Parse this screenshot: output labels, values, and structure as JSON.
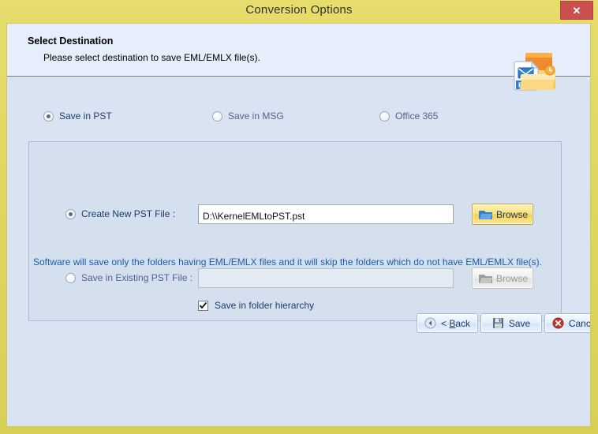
{
  "window": {
    "title": "Conversion Options",
    "close_label": "✕",
    "frame_color": "#ddd45c",
    "panel_color": "#d9e3f1",
    "close_color": "#c9504f"
  },
  "header": {
    "title": "Select Destination",
    "subtitle": "Please select destination to save EML/EMLX file(s).",
    "icon_name": "eml-file-folder-icon",
    "icon_text": "EML"
  },
  "destination_types": [
    {
      "label": "Save in PST",
      "selected": true
    },
    {
      "label": "Save in MSG",
      "selected": false
    },
    {
      "label": "Office 365",
      "selected": false
    }
  ],
  "pst_options": {
    "create_new": {
      "label": "Create New PST File :",
      "selected": true,
      "value": "D:\\\\KernelEMLtoPST.pst",
      "placeholder": "",
      "enabled": true,
      "browse_label": "Browse"
    },
    "save_existing": {
      "label": "Save in Existing PST File :",
      "selected": false,
      "value": "",
      "placeholder": "",
      "enabled": false,
      "browse_label": "Browse"
    },
    "folder_hierarchy": {
      "label": "Save in folder hierarchy",
      "checked": true
    }
  },
  "note": "Software will save only the folders having EML/EMLX files and it will skip the folders which do not have EML/EMLX file(s).",
  "footer": {
    "back_label_pre": "< ",
    "back_label_accel": "B",
    "back_label_post": "ack",
    "save_label": "Save",
    "cancel_label": "Cancel"
  }
}
